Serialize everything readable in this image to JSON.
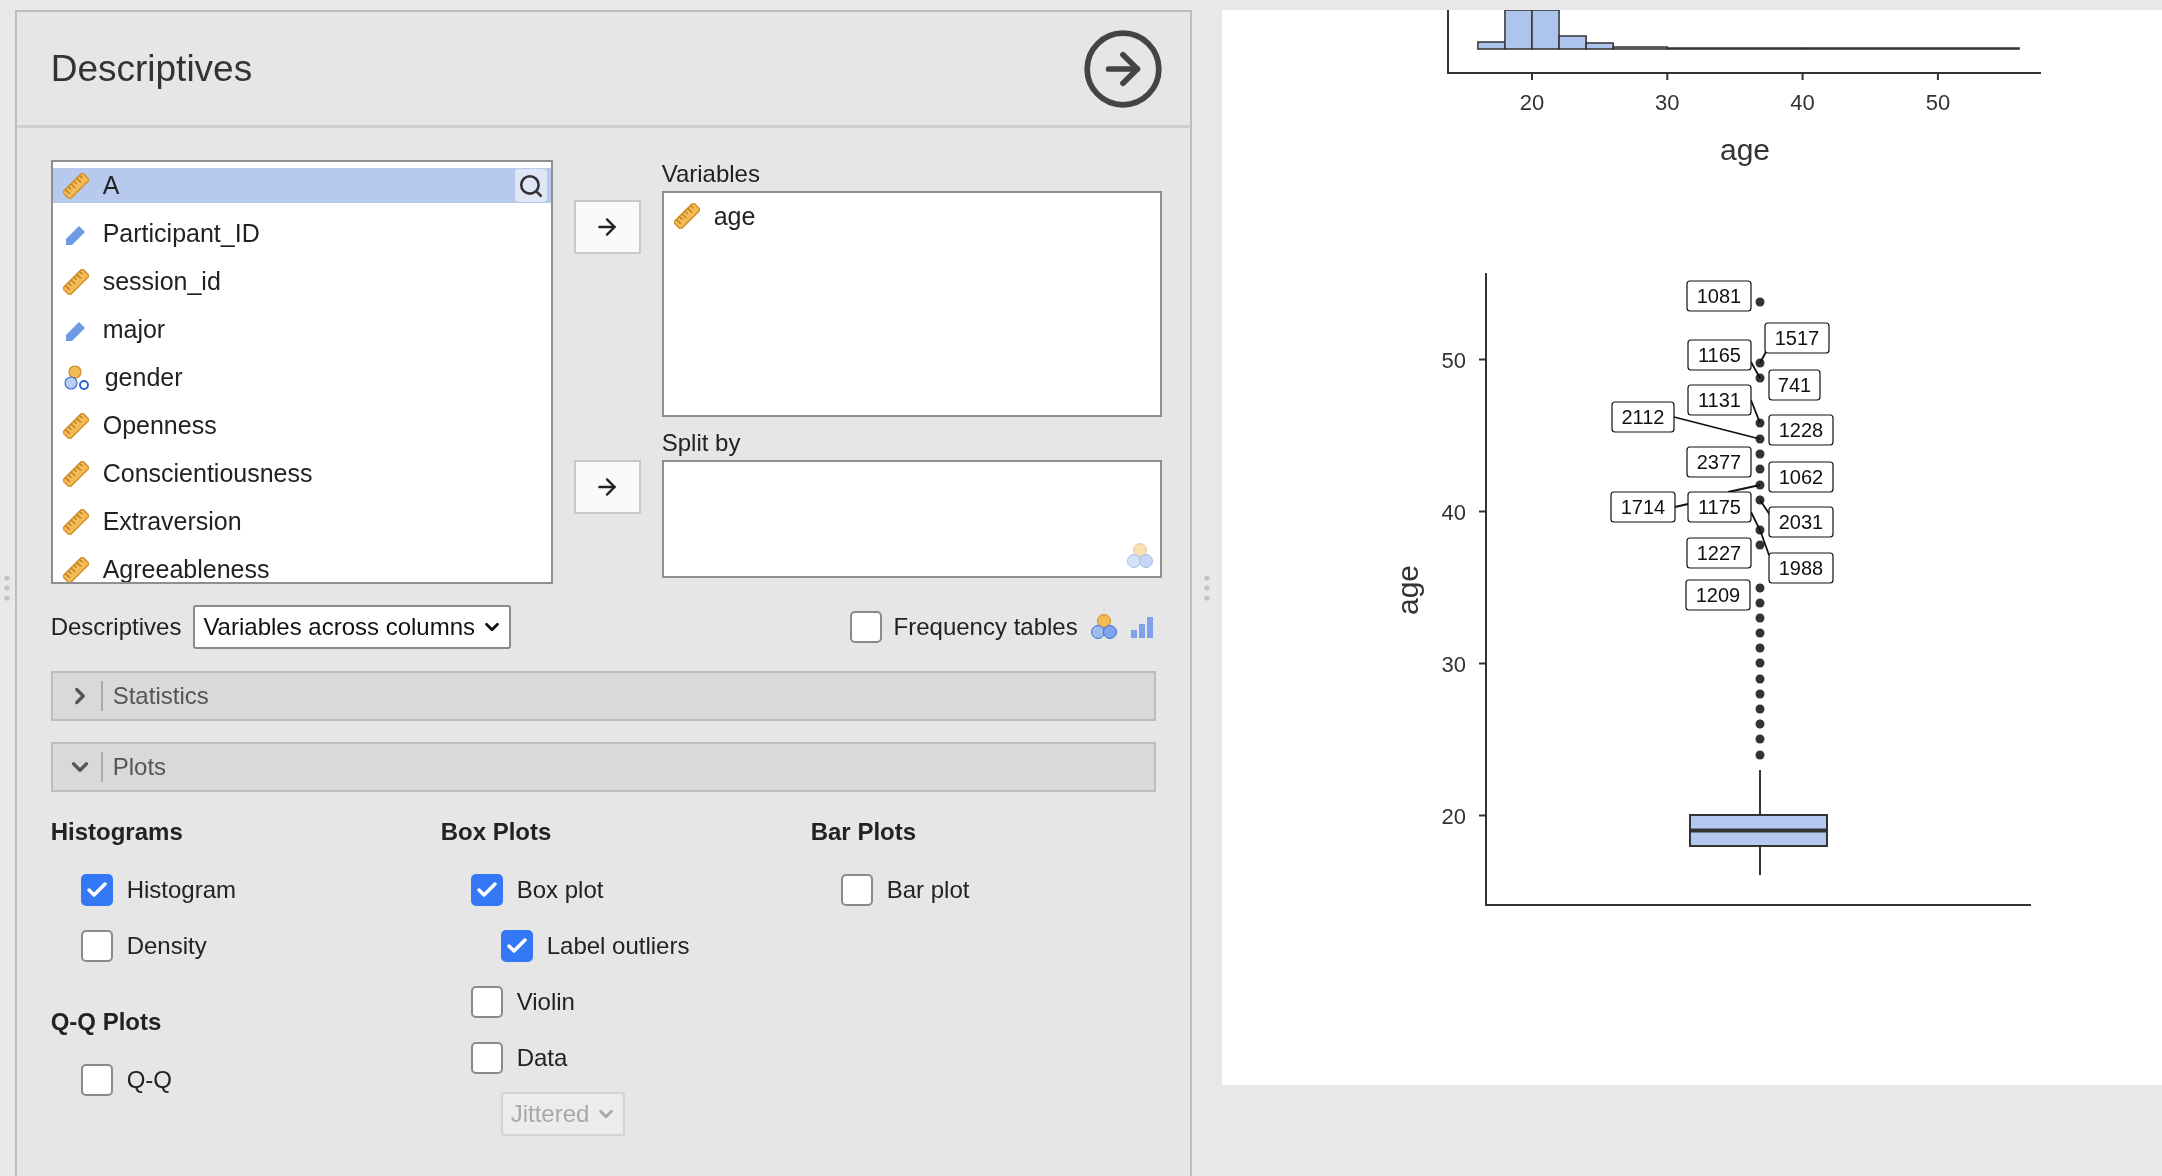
{
  "panel": {
    "title": "Descriptives"
  },
  "variable_list": [
    {
      "name": "A",
      "kind": "continuous",
      "selected": true
    },
    {
      "name": "Participant_ID",
      "kind": "id",
      "selected": false
    },
    {
      "name": "session_id",
      "kind": "continuous",
      "selected": false
    },
    {
      "name": "major",
      "kind": "id",
      "selected": false
    },
    {
      "name": "gender",
      "kind": "nominal",
      "selected": false
    },
    {
      "name": "Openness",
      "kind": "continuous",
      "selected": false
    },
    {
      "name": "Conscientiousness",
      "kind": "continuous",
      "selected": false
    },
    {
      "name": "Extraversion",
      "kind": "continuous",
      "selected": false
    },
    {
      "name": "Agreeableness",
      "kind": "continuous",
      "selected": false
    }
  ],
  "targets": [
    {
      "label": "Variables",
      "items": [
        {
          "name": "age",
          "kind": "continuous"
        }
      ]
    },
    {
      "label": "Split by"
    }
  ],
  "layout_option": {
    "label": "Descriptives",
    "value": "Variables across columns"
  },
  "frequency_tables": {
    "label": "Frequency tables",
    "checked": false
  },
  "sections": [
    {
      "label": "Statistics",
      "expanded": false
    },
    {
      "label": "Plots",
      "expanded": true
    }
  ],
  "plot_columns": [
    [
      {
        "heading": "Histograms",
        "options": [
          {
            "kind": "checkbox",
            "label": "Histogram",
            "checked": true
          },
          {
            "kind": "checkbox",
            "label": "Density",
            "checked": false
          }
        ]
      },
      {
        "heading": "Q-Q Plots",
        "options": [
          {
            "kind": "checkbox",
            "label": "Q-Q",
            "checked": false
          }
        ]
      }
    ],
    [
      {
        "heading": "Box Plots",
        "options": [
          {
            "kind": "checkbox",
            "label": "Box plot",
            "checked": true,
            "children": [
              {
                "kind": "checkbox",
                "label": "Label outliers",
                "checked": true
              }
            ]
          },
          {
            "kind": "checkbox",
            "label": "Violin",
            "checked": false
          },
          {
            "kind": "checkbox",
            "label": "Data",
            "checked": false
          },
          {
            "kind": "select",
            "value": "Jittered",
            "disabled": true
          }
        ]
      }
    ],
    [
      {
        "heading": "Bar Plots",
        "options": [
          {
            "kind": "checkbox",
            "label": "Bar plot",
            "checked": false
          }
        ]
      }
    ]
  ],
  "histogram": {
    "xticks": [
      "20",
      "30",
      "40",
      "50"
    ],
    "xlabel": "age"
  },
  "boxplot": {
    "ylabel": "age",
    "yticks": [
      "50",
      "40",
      "30",
      "20"
    ],
    "outlier_labels": [
      "1081",
      "1517",
      "1165",
      "741",
      "1131",
      "2112",
      "1228",
      "2377",
      "1062",
      "1714",
      "1175",
      "2031",
      "1227",
      "1988",
      "1209"
    ]
  }
}
